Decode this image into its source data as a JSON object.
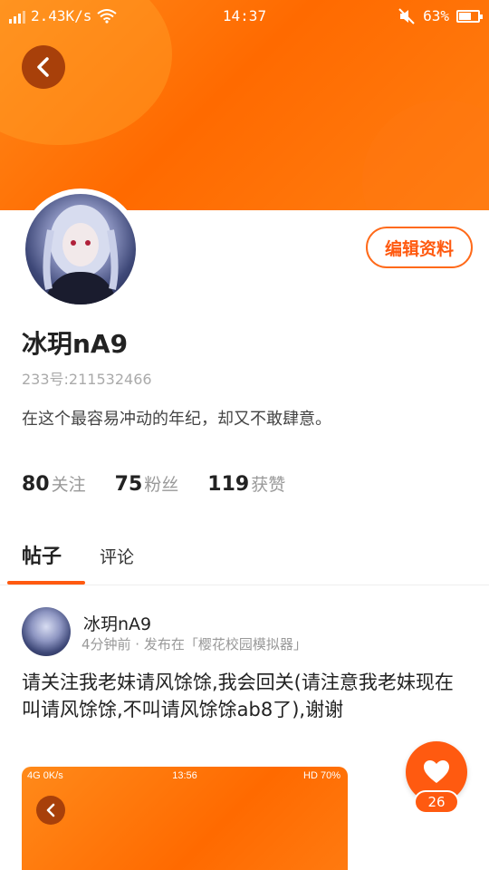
{
  "status_bar": {
    "network_speed": "2.43K/s",
    "time": "14:37",
    "battery": "63%",
    "battery_level": 0.63
  },
  "profile": {
    "username": "冰玥nA9",
    "uid": "233号:211532466",
    "bio": "在这个最容易冲动的年纪，却又不敢肆意。",
    "edit_label": "编辑资料",
    "stats": [
      {
        "num": "80",
        "label": "关注"
      },
      {
        "num": "75",
        "label": "粉丝"
      },
      {
        "num": "119",
        "label": "获赞"
      }
    ]
  },
  "tabs": {
    "posts": "帖子",
    "comments": "评论"
  },
  "post": {
    "author": "冰玥nA9",
    "meta": "4分钟前 · 发布在「樱花校园模拟器」",
    "text": "请关注我老妹请风馀馀,我会回关(请注意我老妹现在叫请风馀馀,不叫请风馀馀ab8了),谢谢",
    "image_status": {
      "left": "4G 0K/s",
      "time": "13:56",
      "right": "HD 70%"
    }
  },
  "like": {
    "count": "26"
  },
  "colors": {
    "accent": "#ff5a10",
    "banner": "#ff6a00",
    "back_button": "#a8400a"
  }
}
